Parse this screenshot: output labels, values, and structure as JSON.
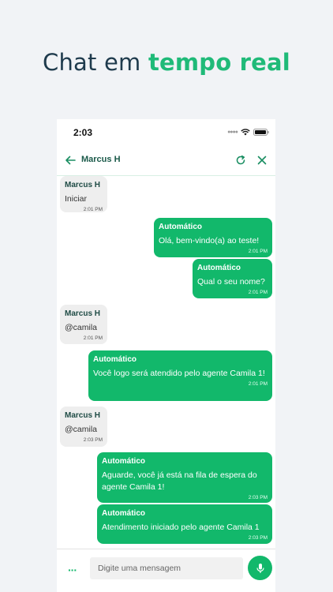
{
  "headline": {
    "prefix": "Chat em ",
    "accent": "tempo real"
  },
  "statusbar": {
    "time": "2:03"
  },
  "chat": {
    "contact_name": "Marcus H"
  },
  "messages": [
    {
      "direction": "in",
      "sender": "Marcus H",
      "text": "Iniciar",
      "time": "2:01 PM"
    },
    {
      "direction": "out",
      "sender": "Automático",
      "text": "Olá, bem-vindo(a) ao teste!",
      "time": "2:01 PM"
    },
    {
      "direction": "out",
      "sender": "Automático",
      "text": "Qual o seu nome?",
      "time": "2:01 PM"
    },
    {
      "direction": "in",
      "sender": "Marcus H",
      "text": "@camila",
      "time": "2:01 PM"
    },
    {
      "direction": "out",
      "sender": "Automático",
      "text": "Você logo será atendido pelo agente Camila 1!",
      "time": "2:01 PM"
    },
    {
      "direction": "in",
      "sender": "Marcus H",
      "text": "@camila",
      "time": "2:03 PM"
    },
    {
      "direction": "out",
      "sender": "Automático",
      "text": "Aguarde, você já está na fila de espera do agente Camila 1!",
      "time": "2:03 PM"
    },
    {
      "direction": "out",
      "sender": "Automático",
      "text": "Atendimento iniciado pelo agente Camila 1",
      "time": "2:03 PM"
    }
  ],
  "composer": {
    "placeholder": "Digite uma mensagem"
  },
  "colors": {
    "accent": "#12b86b",
    "headline": "#1e3a4c",
    "incoming_bubble": "#eeeeee"
  }
}
